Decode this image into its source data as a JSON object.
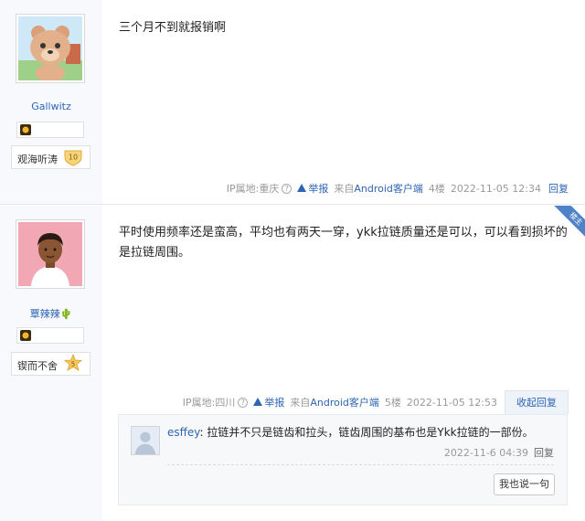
{
  "posts": [
    {
      "user": {
        "name": "Gallwitz",
        "badge_name": "观海听涛",
        "badge_level": "10"
      },
      "content": "三个月不到就报销啊",
      "meta": {
        "ip": "IP属地:重庆",
        "report": "举报",
        "source_prefix": "来自",
        "source": "Android客户端",
        "floor": "4楼",
        "time": "2022-11-05 12:34",
        "reply": "回复"
      }
    },
    {
      "user": {
        "name": "覃辣辣🌵",
        "badge_name": "锲而不舍",
        "badge_level": "5"
      },
      "ribbon": "楼主",
      "content": "平时使用频率还是蛮高，平均也有两天一穿，ykk拉链质量还是可以，可以看到损坏的是拉链周围。",
      "meta": {
        "ip": "IP属地:四川",
        "report": "举报",
        "source_prefix": "来自",
        "source": "Android客户端",
        "floor": "5楼",
        "time": "2022-11-05 12:53",
        "collapse": "收起回复"
      },
      "subreply": {
        "user": "esffey",
        "text": ": 拉链并不只是链齿和拉头，链齿周围的基布也是Ykk拉链的一部份。",
        "time": "2022-11-6 04:39",
        "reply": "回复",
        "say_button": "我也说一句"
      }
    }
  ],
  "colors": {
    "link": "#2d64b3",
    "ribbon": "#4f82c8",
    "sidebar": "#f7f9fc"
  }
}
